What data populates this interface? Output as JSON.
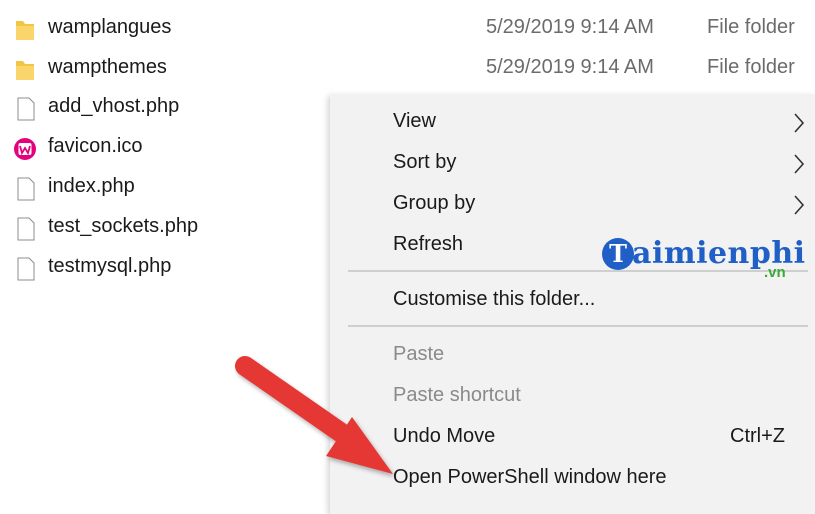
{
  "files": [
    {
      "name": "wamplangues",
      "date": "5/29/2019 9:14 AM",
      "type": "File folder",
      "icon": "folder-icon"
    },
    {
      "name": "wampthemes",
      "date": "5/29/2019 9:14 AM",
      "type": "File folder",
      "icon": "folder-icon"
    },
    {
      "name": "add_vhost.php",
      "date": "",
      "type": "",
      "icon": "file-icon"
    },
    {
      "name": "favicon.ico",
      "date": "",
      "type": "",
      "icon": "wamp-icon"
    },
    {
      "name": "index.php",
      "date": "",
      "type": "",
      "icon": "file-icon"
    },
    {
      "name": "test_sockets.php",
      "date": "",
      "type": "",
      "icon": "file-icon"
    },
    {
      "name": "testmysql.php",
      "date": "",
      "type": "",
      "icon": "file-icon"
    }
  ],
  "context_menu": {
    "items": [
      {
        "label": "View",
        "submenu": true
      },
      {
        "label": "Sort by",
        "submenu": true
      },
      {
        "label": "Group by",
        "submenu": true
      },
      {
        "label": "Refresh"
      },
      {
        "label": "Customise this folder..."
      },
      {
        "label": "Paste",
        "disabled": true
      },
      {
        "label": "Paste shortcut",
        "disabled": true
      },
      {
        "label": "Undo Move",
        "shortcut": "Ctrl+Z"
      },
      {
        "label": "Open PowerShell window here"
      }
    ]
  },
  "watermark": {
    "brand": "aimienphi",
    "initial": "T",
    "domain": ".vn"
  },
  "colors": {
    "menu_bg": "#f2f2f2",
    "folder": "#f4c542",
    "arrow": "#e53935",
    "watermark_blue": "#1f5fc6",
    "watermark_green": "#3aa83a",
    "wamp_pink": "#e5007e"
  }
}
